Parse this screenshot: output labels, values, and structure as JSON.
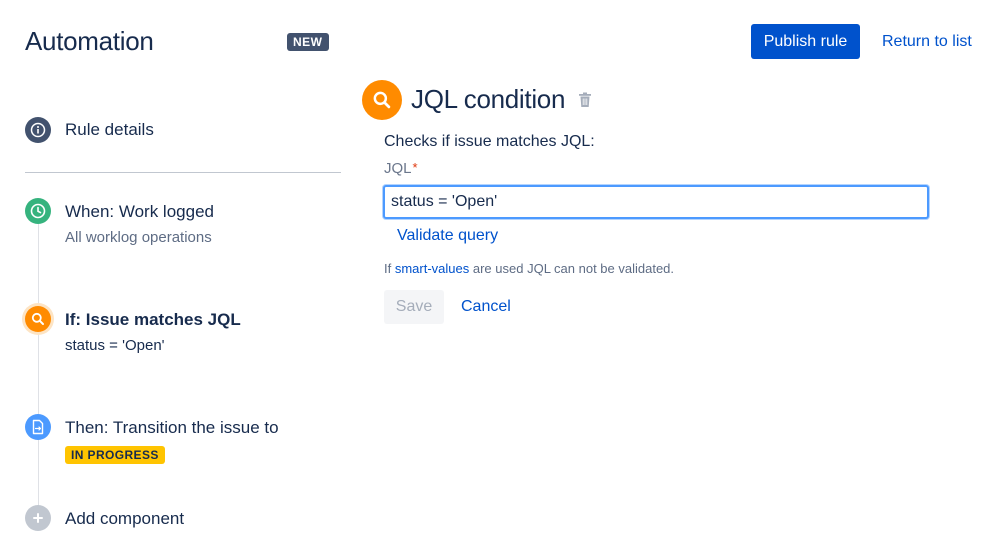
{
  "header": {
    "title": "Automation",
    "badge": "NEW",
    "publish_label": "Publish rule",
    "return_label": "Return to list"
  },
  "sidebar": {
    "rule_details": {
      "icon": "info-icon",
      "title": "Rule details"
    },
    "trigger": {
      "icon": "clock-icon",
      "title": "When: Work logged",
      "subtitle": "All worklog operations"
    },
    "condition": {
      "icon": "search-icon",
      "title": "If: Issue matches JQL",
      "subtitle": "status = 'Open'"
    },
    "action": {
      "icon": "transition-icon",
      "title": "Then: Transition the issue to",
      "status_lozenge": "IN PROGRESS"
    },
    "add": {
      "icon": "plus-icon",
      "title": "Add component"
    }
  },
  "panel": {
    "title": "JQL condition",
    "description": "Checks if issue matches JQL:",
    "field_label": "JQL",
    "required_marker": "*",
    "input_value": "status = 'Open'",
    "validate_label": "Validate query",
    "note_prefix": "If ",
    "note_link": "smart-values",
    "note_suffix": " are used JQL can not be validated.",
    "save_label": "Save",
    "cancel_label": "Cancel"
  },
  "colors": {
    "primary": "#0052cc",
    "trigger_green": "#36b37e",
    "condition_orange": "#ff8b00",
    "action_blue": "#4c9aff",
    "lozenge_yellow": "#ffc400"
  }
}
